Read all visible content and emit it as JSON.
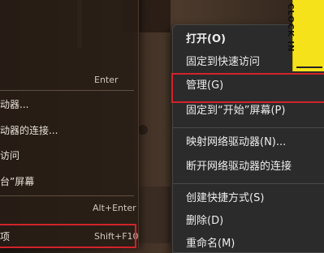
{
  "left_menu": {
    "items": [
      {
        "label": "",
        "shortcut": "Enter"
      },
      {
        "label": "动器...",
        "shortcut": ""
      },
      {
        "label": "动器的连接...",
        "shortcut": ""
      },
      {
        "label": "访问",
        "shortcut": ""
      },
      {
        "label": "台”屏幕",
        "shortcut": ""
      },
      {
        "label": "",
        "shortcut": "Alt+Enter"
      },
      {
        "label": "项",
        "shortcut": "Shift+F10"
      }
    ]
  },
  "right_menu": {
    "items": [
      "打开(O)",
      "固定到快速访问",
      "管理(G)",
      "固定到“开始”屏幕(P)",
      "映射网络驱动器(N)...",
      "断开网络驱动器的连接",
      "创建快捷方式(S)",
      "删除(D)",
      "重命名(M)"
    ]
  },
  "sticky_note": {
    "text": "CLOCK IN"
  },
  "colors": {
    "highlight": "#d2232a",
    "sticky": "#f5e21a",
    "menu_bg": "#2b2b2b"
  }
}
